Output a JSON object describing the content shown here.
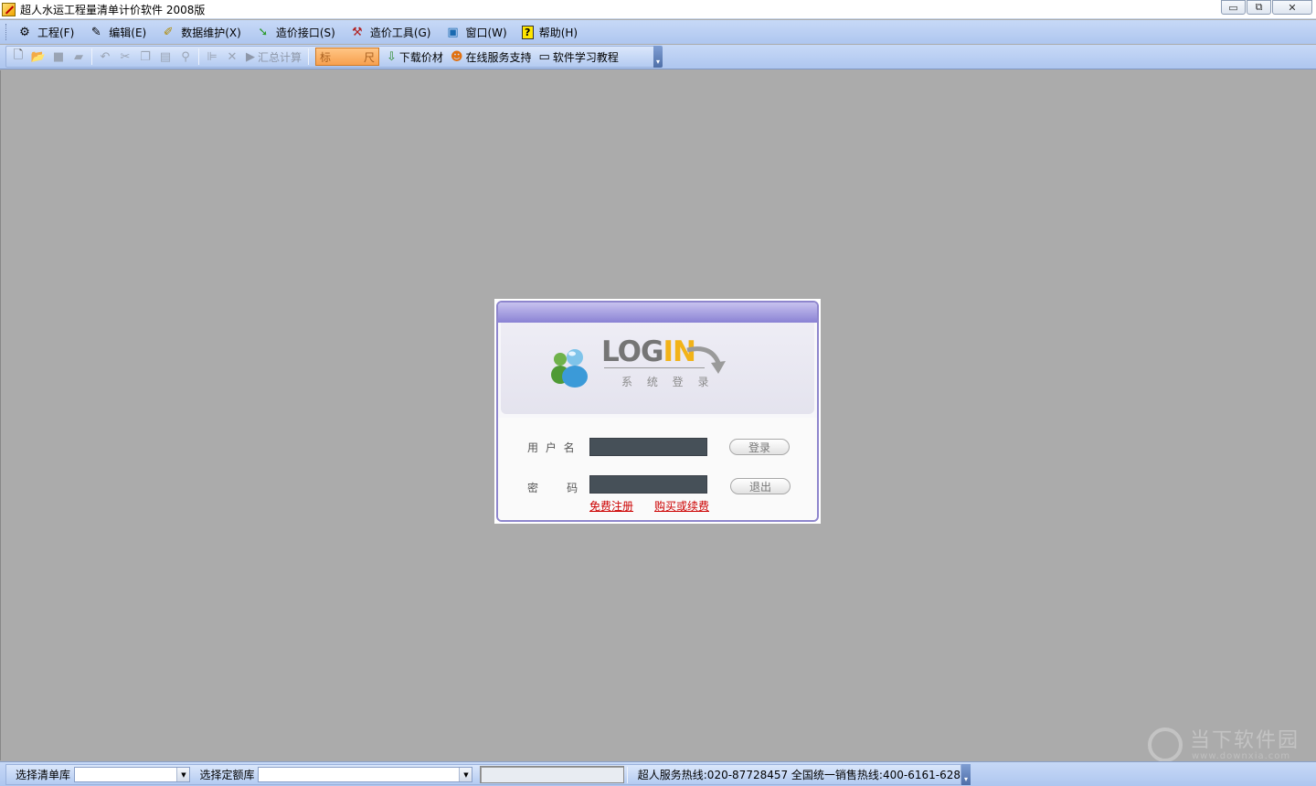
{
  "window": {
    "title": "超人水运工程量清单计价软件 2008版",
    "controls": {
      "minimize": "▭",
      "restore": "⧉",
      "close": "✕"
    }
  },
  "menu": [
    {
      "label": "工程(F)",
      "icon": "project-icon"
    },
    {
      "label": "编辑(E)",
      "icon": "edit-icon"
    },
    {
      "label": "数据维护(X)",
      "icon": "data-maintenance-icon"
    },
    {
      "label": "造价接口(S)",
      "icon": "price-interface-icon"
    },
    {
      "label": "造价工具(G)",
      "icon": "price-tools-icon"
    },
    {
      "label": "窗口(W)",
      "icon": "window-icon"
    },
    {
      "label": "帮助(H)",
      "icon": "help-icon"
    }
  ],
  "toolbar": {
    "summary_calc": "汇总计算",
    "orange_left": "标",
    "orange_right": "尺",
    "download_prices": "下载价材",
    "online_support": "在线服务支持",
    "tutorial": "软件学习教程"
  },
  "login": {
    "logo_log": "LOG",
    "logo_in": "IN",
    "subtitle": "系 统 登 录",
    "username_label": "用 户 名",
    "password_label": "密     码",
    "username_value": "",
    "password_value": "",
    "login_button": "登录",
    "exit_button": "退出",
    "register_link": "免费注册",
    "buy_link": "购买或续费"
  },
  "statusbar": {
    "list_lib_label": "选择清单库",
    "list_lib_value": "",
    "quota_lib_label": "选择定额库",
    "quota_lib_value": "",
    "hotline": "超人服务热线:020-87728457  全国统一销售热线:400-6161-628"
  },
  "watermark": {
    "text": "当下软件园",
    "url": "www.downxia.com"
  },
  "colors": {
    "menubar": "#aec6ef",
    "workspace": "#ababab",
    "login_frame": "#8e86cd",
    "input_bg": "#465058",
    "link": "#cc0000"
  }
}
